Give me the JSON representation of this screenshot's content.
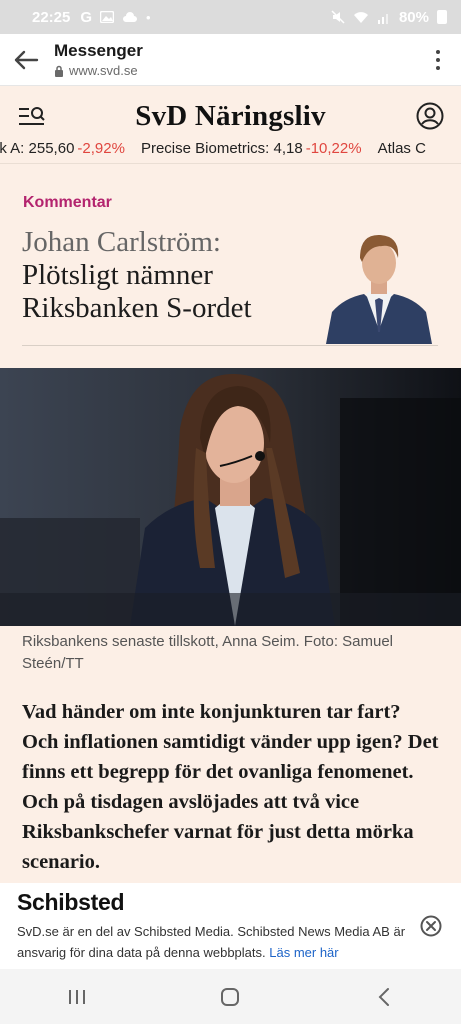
{
  "status": {
    "time": "22:25",
    "icons": [
      "google-icon",
      "image-icon",
      "cloud-icon",
      "dot-icon"
    ],
    "battery": "80%"
  },
  "browser": {
    "title": "Messenger",
    "url": "www.svd.se"
  },
  "site": {
    "logo": "SvD Näringsliv"
  },
  "ticker": [
    {
      "name": "ik A:",
      "value": "255,60",
      "change": "-2,92%"
    },
    {
      "name": "Precise Biometrics:",
      "value": "4,18",
      "change": "-10,22%"
    },
    {
      "name": "Atlas C",
      "value": "",
      "change": ""
    }
  ],
  "article": {
    "section": "Kommentar",
    "author": "Johan Carlström:",
    "title": "Plötsligt nämner Riksbanken S-ordet",
    "caption": "Riksbankens senaste tillskott, Anna Seim. Foto: Samuel Steén/TT",
    "lead": "Vad händer om inte konjunkturen tar fart? Och inflationen samtidigt vänder upp igen? Det finns ett begrepp för det ovanliga fenomenet. Och på tisdagen avslöjades att två vice Riksbankschefer varnat för just detta mörka scenario."
  },
  "banner": {
    "logo": "Schibsted",
    "text": "SvD.se är en del av Schibsted Media. Schibsted News Media AB är ansvarig för dina data på denna webbplats.",
    "link": "Läs mer här"
  },
  "colors": {
    "accent": "#b3246e",
    "negative": "#e0463f",
    "background": "#fcefe6",
    "link": "#1d64c8"
  }
}
